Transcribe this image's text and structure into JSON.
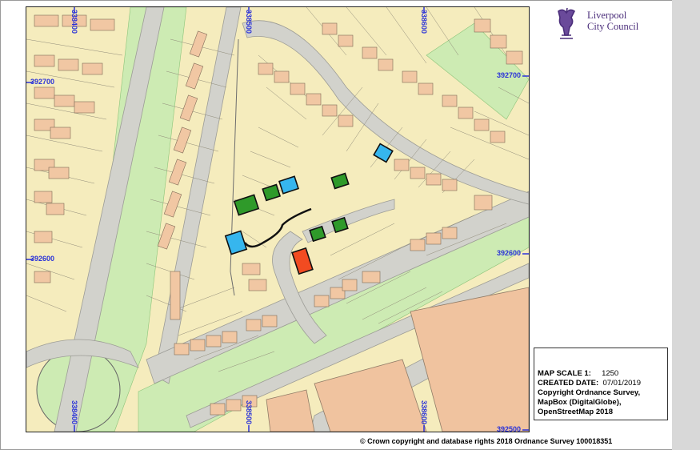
{
  "logo": {
    "line1": "Liverpool",
    "line2": "City Council"
  },
  "grid": {
    "eastings_top": [
      "338400",
      "338500",
      "338600"
    ],
    "eastings_bottom": [
      "338400",
      "338500",
      "338600"
    ],
    "northings_left": [
      "392700",
      "392600"
    ],
    "northings_right": [
      "392700",
      "392600",
      "392500"
    ]
  },
  "info": {
    "scale_label": "MAP SCALE 1:",
    "scale_value": "1250",
    "created_label": "CREATED DATE:",
    "created_value": "07/01/2019",
    "copyright_line1": "Copyright Ordnance Survey,",
    "copyright_line2": "MapBox (DigitalGlobe),",
    "copyright_line3": "OpenStreetMap 2018"
  },
  "footer": {
    "copyright": "© Crown copyright and database rights 2018 Ordnance Survey 100018351"
  },
  "colors": {
    "building": "#f1c7a3",
    "land": "#f5ecbd",
    "road": "#d2d2cc",
    "green": "#cdebb3",
    "highlight_green": "#2f9a2a",
    "highlight_blue": "#36b6ee",
    "highlight_red": "#f24b21",
    "grid_blue": "#2a32d8"
  }
}
